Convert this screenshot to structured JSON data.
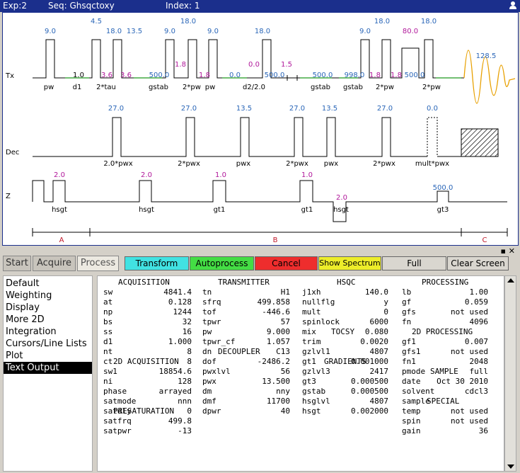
{
  "titlebar": {
    "exp": "Exp:2",
    "seq": "Seq: Ghsqctoxy",
    "index": "Index: 1"
  },
  "colors": {
    "title_bg": "#1b2f8c",
    "blue": "#2a66b8",
    "magenta": "#b0179a",
    "red": "#c0182a",
    "gold": "#e8a000",
    "green": "#44aa44"
  },
  "sequence": {
    "row_labels": [
      "Tx",
      "Dec",
      "Z"
    ],
    "tx_top": [
      "9.0",
      "4.5",
      "18.0",
      "13.5",
      "9.0",
      "18.0",
      "9.0",
      "18.0",
      "9.0",
      "18.0",
      "18.0",
      "128.5"
    ],
    "tx_top_m": [
      "80.0"
    ],
    "tx_mid": [
      "1.8",
      "1.8",
      "0.0",
      "1.5",
      "1.8",
      "1.8"
    ],
    "tx_mid_blue": [
      "500.0",
      "0.0",
      "500.0",
      "500.0",
      "998.0",
      "500.0"
    ],
    "tx_low_m": [
      "3.6",
      "3.6"
    ],
    "tx_low_k": [
      "1.0"
    ],
    "tx_bottom": [
      "pw",
      "d1",
      "2*tau",
      "gstab",
      "2*pw",
      "pw",
      "d2/2.0",
      "gstab",
      "gstab",
      "2*pw",
      "2*pw"
    ],
    "dec_top": [
      "27.0",
      "27.0",
      "13.5",
      "27.0",
      "13.5",
      "27.0",
      "0.0"
    ],
    "dec_bottom": [
      "2.0*pwx",
      "2*pwx",
      "pwx",
      "2*pwx",
      "pwx",
      "2*pwx",
      "mult*pwx"
    ],
    "z_top_m": [
      "2.0",
      "2.0",
      "1.0",
      "1.0",
      "2.0"
    ],
    "z_top_b": [
      "500.0"
    ],
    "z_bottom": [
      "hsgt",
      "hsgt",
      "gt1",
      "gt1",
      "hsgt",
      "gt3"
    ],
    "section_labels": [
      "A",
      "B",
      "C"
    ]
  },
  "tabs": [
    "Start",
    "Acquire",
    "Process"
  ],
  "active_tab": "Process",
  "buttons": {
    "transform": "Transform",
    "autoprocess": "Autoprocess",
    "cancel": "Cancel",
    "show_spectrum": "Show Spectrum",
    "full": "Full",
    "clear_screen": "Clear Screen"
  },
  "sidebar": [
    "Default",
    "Weighting",
    "Display",
    "More 2D",
    "Integration",
    "Cursors/Line Lists",
    "Plot",
    "Text Output"
  ],
  "sidebar_selected": "Text Output",
  "params": {
    "c1_head": [
      "ACQUISITION",
      "2D ACQUISITION",
      "PRESATURATION"
    ],
    "c1_name": [
      "sw",
      "at",
      "np",
      "bs",
      "ss",
      "d1",
      "nt",
      "ct",
      "sw1",
      "ni",
      "phase",
      "satmode",
      "satdly",
      "satfrq",
      "satpwr"
    ],
    "c1_val": [
      "4841.4",
      "0.128",
      "1244",
      "32",
      "16",
      "1.000",
      "8",
      "8",
      "18854.6",
      "128",
      "arrayed",
      "nnn",
      "0",
      "499.8",
      "-13"
    ],
    "c2_head": [
      "TRANSMITTER",
      "DECOUPLER"
    ],
    "c2_name": [
      "tn",
      "sfrq",
      "tof",
      "tpwr",
      "pw",
      "tpwr_cf",
      "dn",
      "dof",
      "pwxlvl",
      "pwx",
      "dm",
      "dmf",
      "dpwr"
    ],
    "c2_val": [
      "H1",
      "499.858",
      "-446.6",
      "57",
      "9.000",
      "1.057",
      "C13",
      "-2486.2",
      "56",
      "13.500",
      "nny",
      "11700",
      "40"
    ],
    "c3_head": [
      "HSQC",
      "TOCSY",
      "GRADIENTS"
    ],
    "c3_name": [
      "j1xh",
      "nullflg",
      "mult",
      "spinlock",
      "mix",
      "trim",
      "gzlvl1",
      "gt1",
      "gzlvl3",
      "gt3",
      "gstab",
      "hsglvl",
      "hsgt"
    ],
    "c3_val": [
      "140.0",
      "y",
      "0",
      "6000",
      "0.080",
      "0.0020",
      "4807",
      "0.001000",
      "2417",
      "0.000500",
      "0.000500",
      "4807",
      "0.002000"
    ],
    "c4_head": [
      "PROCESSING",
      "2D PROCESSING",
      "SAMPLE",
      "SPECIAL"
    ],
    "c4_name": [
      "lb",
      "gf",
      "gfs",
      "fn",
      "gf1",
      "gfs1",
      "fn1",
      "pmode",
      "date",
      "solvent",
      "sample",
      "temp",
      "spin",
      "gain"
    ],
    "c4_val": [
      "1.00",
      "0.059",
      "not used",
      "4096",
      "0.007",
      "not used",
      "2048",
      "full",
      "Oct 30 2010",
      "cdcl3",
      "",
      "not used",
      "not used",
      "36"
    ]
  }
}
